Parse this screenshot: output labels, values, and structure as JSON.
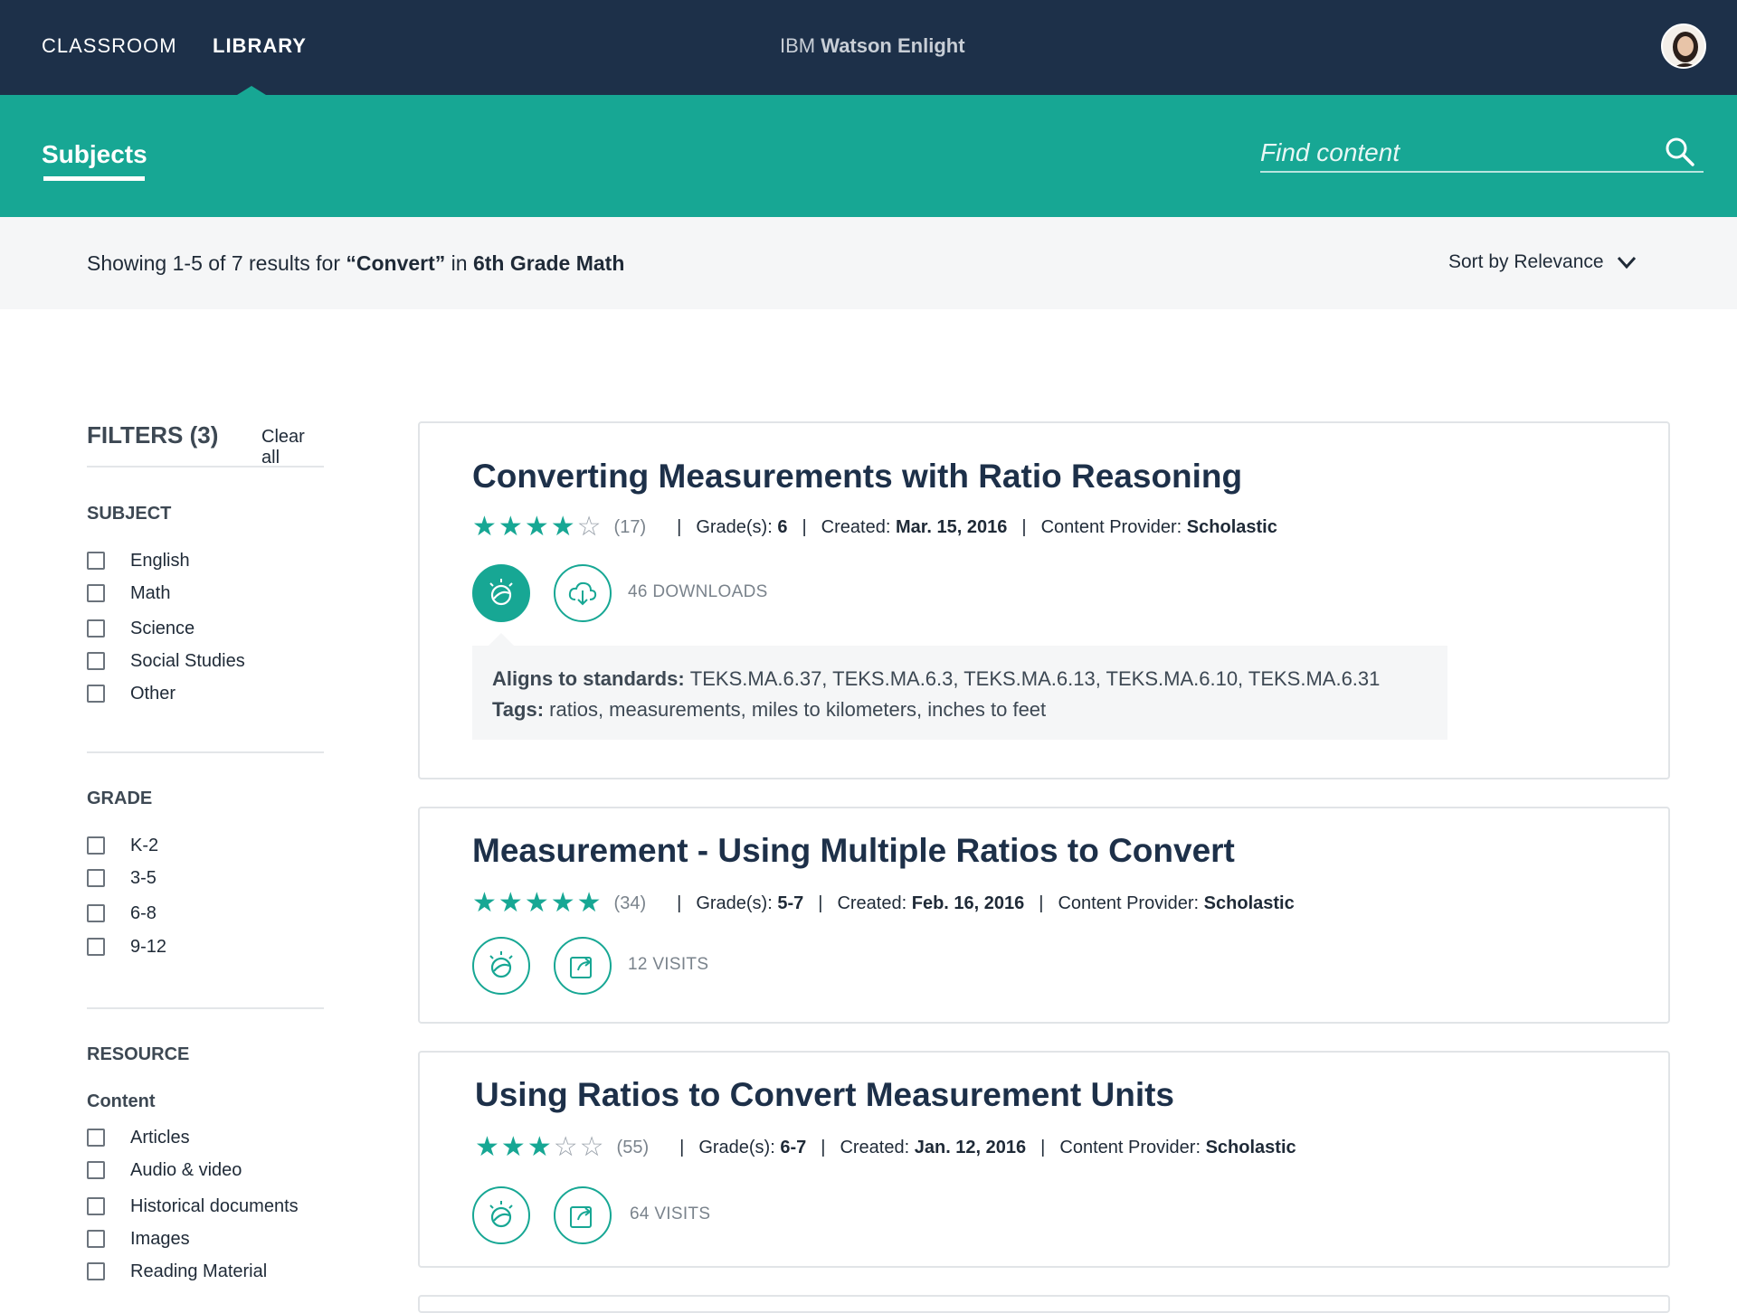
{
  "nav": {
    "classroom": "CLASSROOM",
    "library": "LIBRARY",
    "brand_prefix": "IBM",
    "brand_name": "Watson Enlight"
  },
  "subheader": {
    "subjects_label": "Subjects",
    "search_placeholder": "Find content"
  },
  "results": {
    "prefix": "Showing 1-5 of 7 results for ",
    "query": "“Convert”",
    "in": " in ",
    "scope": "6th Grade Math",
    "sort_label": "Sort by Relevance"
  },
  "filters": {
    "title": "FILTERS (3)",
    "clear_all": "Clear all",
    "subject": {
      "title": "SUBJECT",
      "options": [
        "English",
        "Math",
        "Science",
        "Social Studies",
        "Other"
      ]
    },
    "grade": {
      "title": "GRADE",
      "options": [
        "K-2",
        "3-5",
        "6-8",
        "9-12"
      ]
    },
    "resource": {
      "title": "RESOURCE",
      "subtitle": "Content",
      "options": [
        "Articles",
        "Audio & video",
        "Historical documents",
        "Images",
        "Reading Material"
      ]
    }
  },
  "meta_labels": {
    "grades": "Grade(s): ",
    "created": "Created: ",
    "provider": "Content Provider: ",
    "aligns": "Aligns to standards: ",
    "tags": "Tags: "
  },
  "cards": [
    {
      "title": "Converting Measurements with Ratio Reasoning",
      "rating": 4,
      "rating_max": 5,
      "count": "(17)",
      "grades": "6",
      "created": "Mar. 15, 2016",
      "provider": "Scholastic",
      "stat": "46 DOWNLOADS",
      "stat_icon": "cloud-download-icon",
      "standards": "TEKS.MA.6.37, TEKS.MA.6.3, TEKS.MA.6.13, TEKS.MA.6.10, TEKS.MA.6.31",
      "tags": "ratios, measurements, miles to kilometers, inches to feet"
    },
    {
      "title": "Measurement - Using Multiple Ratios to Convert",
      "rating": 5,
      "rating_max": 5,
      "count": "(34)",
      "grades": "5-7",
      "created": "Feb. 16, 2016",
      "provider": "Scholastic",
      "stat": "12 VISITS",
      "stat_icon": "external-link-icon"
    },
    {
      "title": "Using Ratios to Convert Measurement Units",
      "rating": 3,
      "rating_max": 5,
      "count": "(55)",
      "grades": "6-7",
      "created": "Jan. 12, 2016",
      "provider": "Scholastic",
      "stat": "64 VISITS",
      "stat_icon": "external-link-icon"
    }
  ],
  "colors": {
    "navy": "#1d3049",
    "teal": "#17a794",
    "light_gray": "#f5f6f7"
  }
}
